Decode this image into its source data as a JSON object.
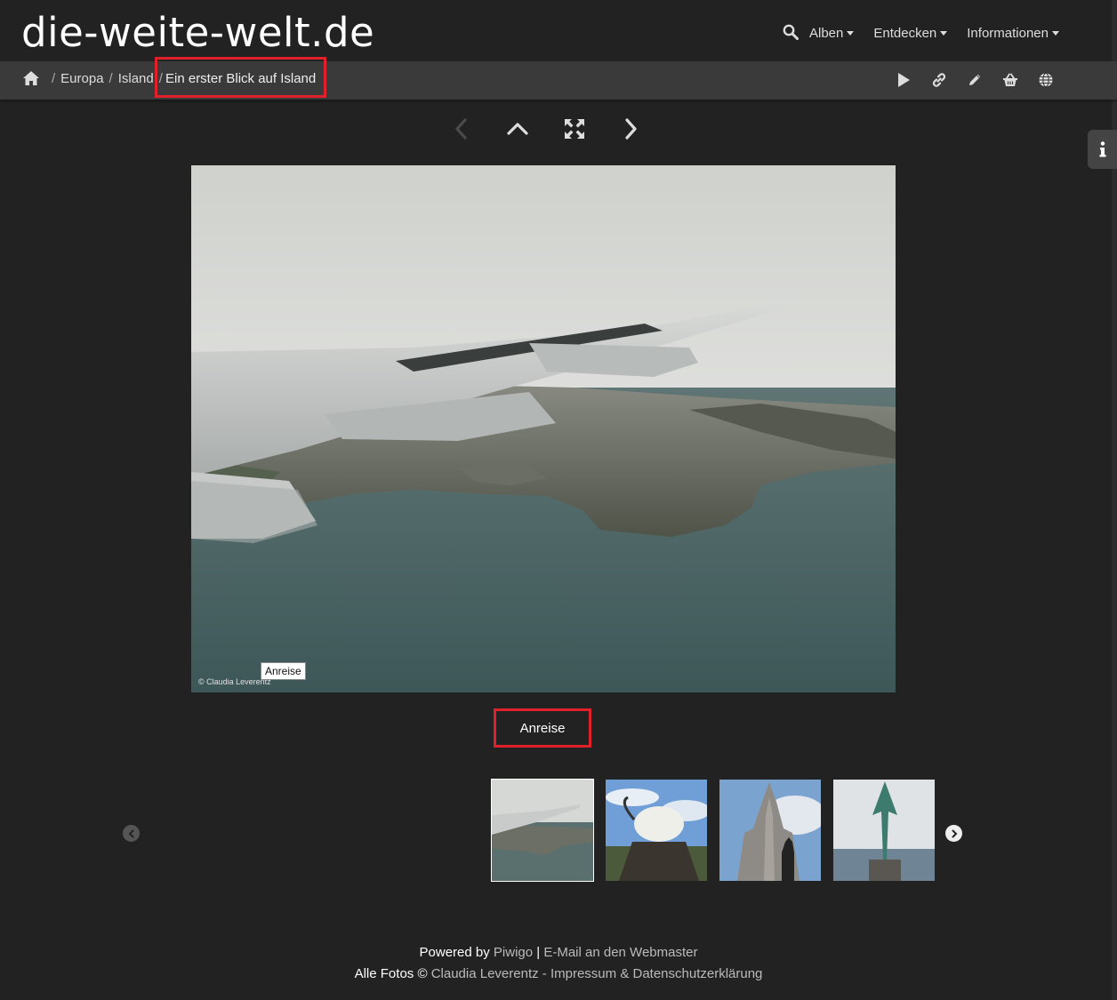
{
  "site": {
    "title": "die-weite-welt.de"
  },
  "nav": {
    "items": [
      {
        "label": "Alben"
      },
      {
        "label": "Entdecken"
      },
      {
        "label": "Informationen"
      }
    ]
  },
  "breadcrumb": {
    "items": [
      "Europa",
      "Island"
    ],
    "separator": "/",
    "current": "Ein erster Blick auf Island"
  },
  "photo": {
    "copyright_watermark": "© Claudia Leverentz",
    "tooltip": "Anreise",
    "caption": "Anreise"
  },
  "footer": {
    "powered_by": "Powered by",
    "piwigo": "Piwigo",
    "pipe": "|",
    "webmaster": "E-Mail an den Webmaster",
    "all_photos": "Alle Fotos",
    "copyright_sign": "©",
    "author": "Claudia Leverentz",
    "dash": "-",
    "impressum": "Impressum & Datenschutzerklärung"
  },
  "colors": {
    "background": "#222222",
    "breadcrumb_bar": "#3a3a3a",
    "highlight": "#e0202a",
    "text": "#dddddd"
  }
}
